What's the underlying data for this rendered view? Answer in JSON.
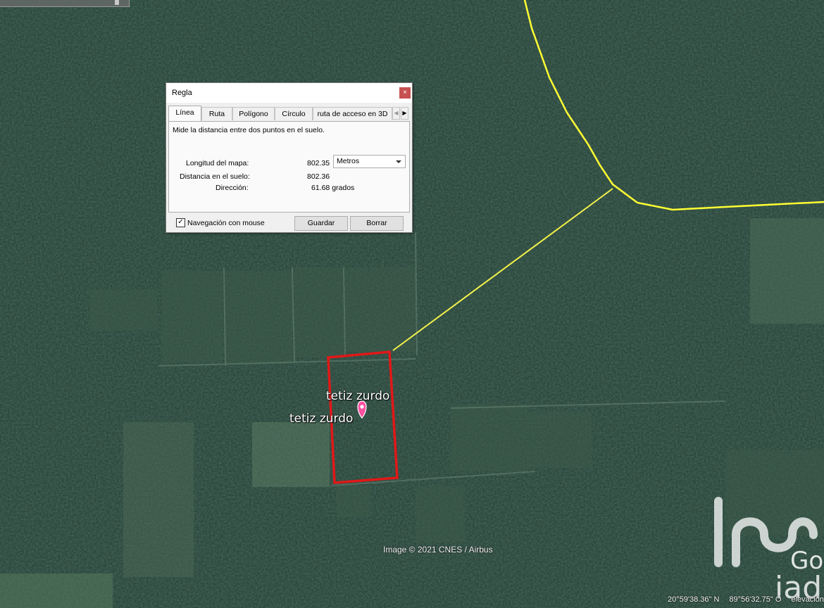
{
  "dialog": {
    "title": "Regla",
    "close_label": "×",
    "tabs": [
      "Línea",
      "Ruta",
      "Polígono",
      "Círculo",
      "ruta de acceso en 3D"
    ],
    "active_tab": "Línea",
    "description": "Mide la distancia entre dos puntos en el suelo.",
    "map_length_label": "Longitud del mapa:",
    "map_length_value": "802.35",
    "unit_selected": "Metros",
    "ground_distance_label": "Distancia en el suelo:",
    "ground_distance_value": "802.36",
    "direction_label": "Dirección:",
    "direction_value": "61.68 grados",
    "mouse_nav_checked": true,
    "mouse_nav_label": "Navegación con mouse",
    "save_label": "Guardar",
    "clear_label": "Borrar"
  },
  "map": {
    "placemark_label_1": "tetiz zurdo",
    "placemark_label_2": "tetiz zurdo",
    "credit": "Image © 2021 CNES / Airbus",
    "latitude": "20°59'38.36\" N",
    "longitude": "89°56'32.75\" O",
    "elevation_label": "elevación",
    "measure_line_color": "#f2f24a",
    "boundary_line_color": "#ffff33",
    "parcel_outline_color": "#e01818",
    "placemark_color": "#ff4fa0",
    "watermark_brand": "iad",
    "watermark_partial": "Go"
  }
}
